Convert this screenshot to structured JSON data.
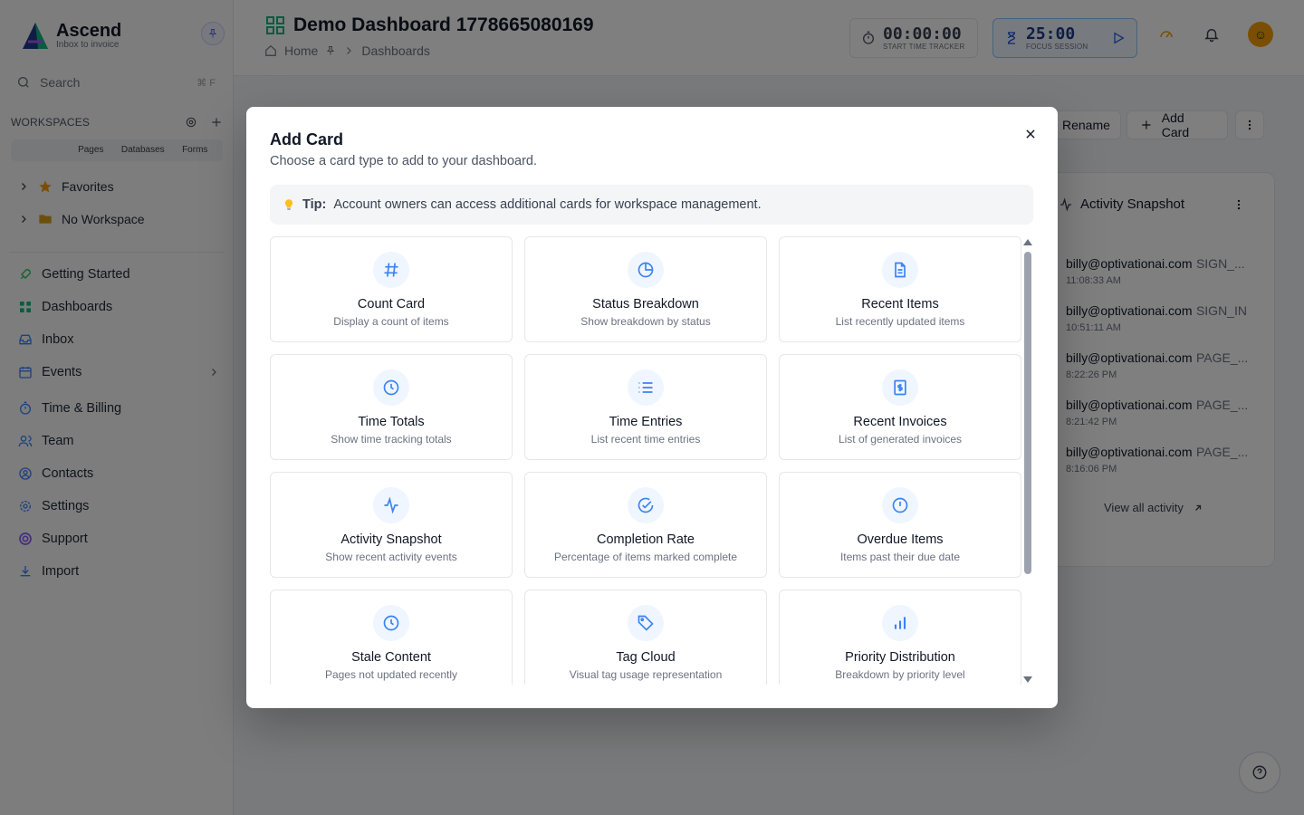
{
  "brand": {
    "name": "Ascend",
    "tagline": "Inbox to invoice"
  },
  "sidebar": {
    "search_placeholder": "Search",
    "search_shortcut": "⌘ F",
    "workspaces_label": "WORKSPACES",
    "ws_tabs": [
      "",
      "Pages",
      "Databases",
      "Forms"
    ],
    "tree": [
      {
        "label": "Favorites",
        "icon": "star-icon"
      },
      {
        "label": "No Workspace",
        "icon": "folder-icon"
      }
    ],
    "nav": [
      {
        "label": "Getting Started",
        "icon": "rocket-icon"
      },
      {
        "label": "Dashboards",
        "icon": "grid-icon"
      },
      {
        "label": "Inbox",
        "icon": "inbox-icon"
      },
      {
        "label": "Events",
        "icon": "calendar-icon"
      },
      {
        "label": "Time & Billing",
        "icon": "stopwatch-icon"
      },
      {
        "label": "Team",
        "icon": "users-icon"
      },
      {
        "label": "Contacts",
        "icon": "contact-icon"
      },
      {
        "label": "Settings",
        "icon": "gear-icon"
      },
      {
        "label": "Support",
        "icon": "lifebuoy-icon"
      },
      {
        "label": "Import",
        "icon": "download-icon"
      }
    ]
  },
  "header": {
    "title": "Demo Dashboard 1778665080169",
    "breadcrumb": [
      "Home",
      "Dashboards"
    ],
    "time_tracker": {
      "value": "00:00:00",
      "caption": "START TIME TRACKER"
    },
    "focus": {
      "value": "25:00",
      "caption": "FOCUS SESSION"
    }
  },
  "toolbar": {
    "rename_label": "Rename",
    "add_card_label": "Add Card"
  },
  "activity": {
    "title": "Activity Snapshot",
    "rows": [
      {
        "who": "billy@optivationai.com",
        "kind": "SIGN_...",
        "time": "11:08:33 AM"
      },
      {
        "who": "billy@optivationai.com",
        "kind": "SIGN_IN",
        "time": "10:51:11 AM"
      },
      {
        "who": "billy@optivationai.com",
        "kind": "PAGE_...",
        "time": "8:22:26 PM"
      },
      {
        "who": "billy@optivationai.com",
        "kind": "PAGE_...",
        "time": "8:21:42 PM"
      },
      {
        "who": "billy@optivationai.com",
        "kind": "PAGE_...",
        "time": "8:16:06 PM"
      }
    ],
    "view_all": "View all activity"
  },
  "modal": {
    "title": "Add Card",
    "subtitle": "Choose a card type to add to your dashboard.",
    "tip_label": "Tip:",
    "tip_text": "Account owners can access additional cards for workspace management.",
    "cards": [
      {
        "name": "Count Card",
        "desc": "Display a count of items",
        "icon": "hash-icon"
      },
      {
        "name": "Status Breakdown",
        "desc": "Show breakdown by status",
        "icon": "pie-chart-icon"
      },
      {
        "name": "Recent Items",
        "desc": "List recently updated items",
        "icon": "file-text-icon"
      },
      {
        "name": "Time Totals",
        "desc": "Show time tracking totals",
        "icon": "clock-icon"
      },
      {
        "name": "Time Entries",
        "desc": "List recent time entries",
        "icon": "list-icon"
      },
      {
        "name": "Recent Invoices",
        "desc": "List of generated invoices",
        "icon": "invoice-icon"
      },
      {
        "name": "Activity Snapshot",
        "desc": "Show recent activity events",
        "icon": "activity-icon"
      },
      {
        "name": "Completion Rate",
        "desc": "Percentage of items marked complete",
        "icon": "check-circle-icon"
      },
      {
        "name": "Overdue Items",
        "desc": "Items past their due date",
        "icon": "alert-circle-icon"
      },
      {
        "name": "Stale Content",
        "desc": "Pages not updated recently",
        "icon": "clock-icon"
      },
      {
        "name": "Tag Cloud",
        "desc": "Visual tag usage representation",
        "icon": "tag-icon"
      },
      {
        "name": "Priority Distribution",
        "desc": "Breakdown by priority level",
        "icon": "bar-chart-icon"
      }
    ]
  },
  "colors": {
    "accent": "#3b82f6",
    "icon_bg": "#eff6ff"
  }
}
